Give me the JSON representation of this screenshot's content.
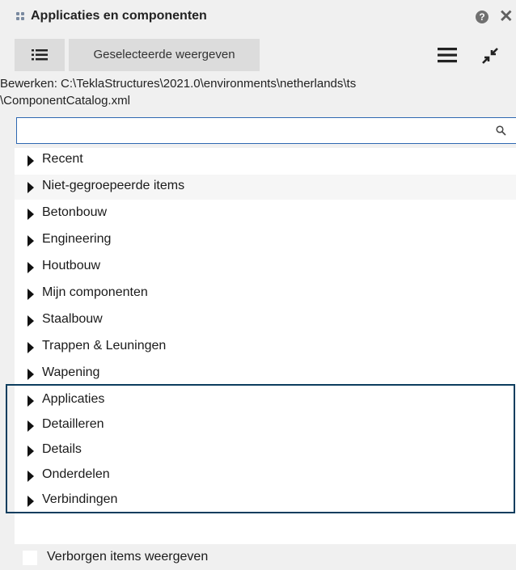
{
  "panel": {
    "title": "Applicaties en componenten",
    "help_icon": "?",
    "close_icon": "✕"
  },
  "toolbar": {
    "list_view_icon": "list-view-icon",
    "show_selected_label": "Geselecteerde weergeven",
    "menu_icon": "hamburger-menu-icon",
    "collapse_icon": "collapse-arrows-icon"
  },
  "edit_path": {
    "line1": "Bewerken:  C:\\TeklaStructures\\2021.0\\environments\\netherlands\\ts",
    "line2": "\\ComponentCatalog.xml"
  },
  "search": {
    "value": "",
    "placeholder": ""
  },
  "tree": {
    "items": [
      {
        "label": "Recent"
      },
      {
        "label": "Niet-gegroepeerde items"
      },
      {
        "label": "Betonbouw"
      },
      {
        "label": "Engineering"
      },
      {
        "label": "Houtbouw"
      },
      {
        "label": "Mijn componenten"
      },
      {
        "label": "Staalbouw"
      },
      {
        "label": "Trappen & Leuningen"
      },
      {
        "label": "Wapening"
      },
      {
        "label": "Applicaties"
      },
      {
        "label": "Detailleren"
      },
      {
        "label": "Details"
      },
      {
        "label": "Onderdelen"
      },
      {
        "label": "Verbindingen"
      }
    ]
  },
  "footer": {
    "show_hidden_label": "Verborgen items weergeven",
    "show_hidden_checked": false
  },
  "colors": {
    "highlight_border": "#0c3d5e",
    "search_border": "#2e67b1",
    "button_bg": "#dcdcdc"
  }
}
